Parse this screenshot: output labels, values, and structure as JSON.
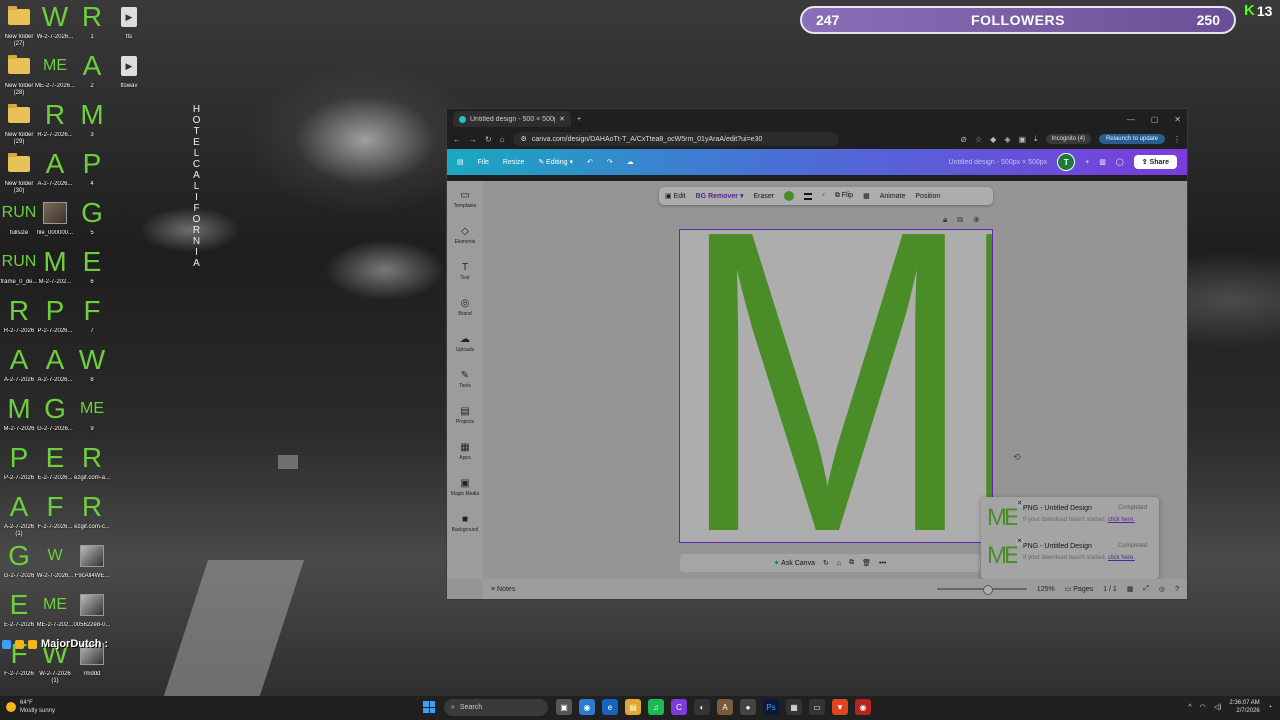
{
  "desktop": {
    "icons": [
      {
        "kind": "folder",
        "label": "New folder\n(27)"
      },
      {
        "kind": "letter",
        "glyph": "W",
        "label": "W-2-7-2026..."
      },
      {
        "kind": "letter",
        "glyph": "R",
        "label": "1"
      },
      {
        "kind": "video",
        "label": "tts"
      },
      {
        "kind": "folder",
        "label": "New folder\n(28)"
      },
      {
        "kind": "letter",
        "glyph": "ME",
        "small": true,
        "label": "ME-2-7-2026..."
      },
      {
        "kind": "letter",
        "glyph": "A",
        "label": "2"
      },
      {
        "kind": "video",
        "label": "ttswav"
      },
      {
        "kind": "folder",
        "label": "New folder\n(29)"
      },
      {
        "kind": "letter",
        "glyph": "R",
        "label": "R-2-7-2026..."
      },
      {
        "kind": "letter",
        "glyph": "M",
        "label": "3"
      },
      {
        "kind": "none",
        "label": ""
      },
      {
        "kind": "folder",
        "label": "New folder\n(30)"
      },
      {
        "kind": "letter",
        "glyph": "A",
        "label": "A-2-7-2026..."
      },
      {
        "kind": "letter",
        "glyph": "P",
        "label": "4"
      },
      {
        "kind": "none",
        "label": ""
      },
      {
        "kind": "letter",
        "glyph": "RUN",
        "small": true,
        "label": "fullsize"
      },
      {
        "kind": "thumb",
        "label": "file_000000..."
      },
      {
        "kind": "letter",
        "glyph": "G",
        "label": "5"
      },
      {
        "kind": "none",
        "label": ""
      },
      {
        "kind": "letter",
        "glyph": "RUN",
        "small": true,
        "label": "frame_0_de..."
      },
      {
        "kind": "letter",
        "glyph": "M",
        "label": "M-2-7-202..."
      },
      {
        "kind": "letter",
        "glyph": "E",
        "label": "6"
      },
      {
        "kind": "none",
        "label": ""
      },
      {
        "kind": "letter",
        "glyph": "R",
        "label": "R-2-7-2026"
      },
      {
        "kind": "letter",
        "glyph": "P",
        "label": "P-2-7-2026..."
      },
      {
        "kind": "letter",
        "glyph": "F",
        "label": "7"
      },
      {
        "kind": "none",
        "label": ""
      },
      {
        "kind": "letter",
        "glyph": "A",
        "label": "A-2-7-2026"
      },
      {
        "kind": "letter",
        "glyph": "A",
        "label": "A-2-7-2026..."
      },
      {
        "kind": "letter",
        "glyph": "W",
        "label": "8"
      },
      {
        "kind": "none",
        "label": ""
      },
      {
        "kind": "letter",
        "glyph": "M",
        "label": "M-2-7-2026"
      },
      {
        "kind": "letter",
        "glyph": "G",
        "label": "G-2-7-2026..."
      },
      {
        "kind": "letter",
        "glyph": "ME",
        "small": true,
        "label": "9"
      },
      {
        "kind": "none",
        "label": ""
      },
      {
        "kind": "letter",
        "glyph": "P",
        "label": "P-2-7-2026"
      },
      {
        "kind": "letter",
        "glyph": "E",
        "label": "E-2-7-2026..."
      },
      {
        "kind": "letter",
        "glyph": "R",
        "label": "ezgif.com-a..."
      },
      {
        "kind": "none",
        "label": ""
      },
      {
        "kind": "letter",
        "glyph": "A",
        "label": "A-2-7-2026\n(1)"
      },
      {
        "kind": "letter",
        "glyph": "F",
        "label": "F-2-7-2026..."
      },
      {
        "kind": "letter",
        "glyph": "R",
        "label": "ezgif.com-c..."
      },
      {
        "kind": "none",
        "label": ""
      },
      {
        "kind": "letter",
        "glyph": "G",
        "label": "G-2-7-2026"
      },
      {
        "kind": "letter",
        "glyph": "W",
        "small": true,
        "label": "W-2-7-2026..."
      },
      {
        "kind": "thumbgr",
        "label": "F9cAll4WE..."
      },
      {
        "kind": "none",
        "label": ""
      },
      {
        "kind": "letter",
        "glyph": "E",
        "label": "E-2-7-2026"
      },
      {
        "kind": "letter",
        "glyph": "ME",
        "small": true,
        "label": "ME-2-7-202..."
      },
      {
        "kind": "thumbgr",
        "label": "005622e8-0..."
      },
      {
        "kind": "none",
        "label": ""
      },
      {
        "kind": "letter",
        "glyph": "F",
        "label": "F-2-7-2026"
      },
      {
        "kind": "letter",
        "glyph": "W",
        "label": "W-2-7-2026\n(1)"
      },
      {
        "kind": "thumbgr",
        "label": "rmddd"
      },
      {
        "kind": "none",
        "label": ""
      }
    ],
    "hotel_sign": "HOTEL CALIFORNIA",
    "username": "MajorDutch :"
  },
  "overlay": {
    "followers_current": "247",
    "followers_label": "FOLLOWERS",
    "followers_goal": "250",
    "kick_count": "13"
  },
  "browser": {
    "tab_title": "Untitled design - 500 × 500px",
    "url": "canva.com/design/DAHAoTt-T_A/CxTtea8_ocW5rm_01yAraA/edit?ui=e30",
    "incognito_label": "Incognito (4)",
    "relaunch_label": "Relaunch to update"
  },
  "canva": {
    "header": {
      "file_label": "File",
      "resize_label": "Resize",
      "editing_label": "Editing",
      "design_title": "Untitled design - 500px × 500px",
      "avatar_letter": "T",
      "share_label": "Share"
    },
    "sidebar": [
      "Templates",
      "Elements",
      "Text",
      "Brand",
      "Uploads",
      "Tools",
      "Projects",
      "Apps",
      "Magic Media",
      "Background"
    ],
    "toolbar": {
      "edit": "Edit",
      "bg_remover": "BG Remover",
      "eraser": "Eraser",
      "flip": "Flip",
      "animate": "Animate",
      "position": "Position",
      "color": "#6ecf3c"
    },
    "canvas_text": "ME",
    "ask_canva": "Ask Canva",
    "notifications": [
      {
        "title": "PNG - Untitled Design",
        "status": "Completed",
        "sub": "If your download hasn't started, ",
        "link": "click here."
      },
      {
        "title": "PNG - Untitled Design",
        "status": "Completed",
        "sub": "If your download hasn't started, ",
        "link": "click here."
      }
    ],
    "footer": {
      "notes": "Notes",
      "zoom": "125%",
      "pages_label": "Pages",
      "page_count": "1 / 1"
    }
  },
  "taskbar": {
    "temperature": "64°F",
    "weather": "Mostly sunny",
    "search_placeholder": "Search",
    "time": "2:36:07 AM",
    "date": "2/7/2026"
  }
}
